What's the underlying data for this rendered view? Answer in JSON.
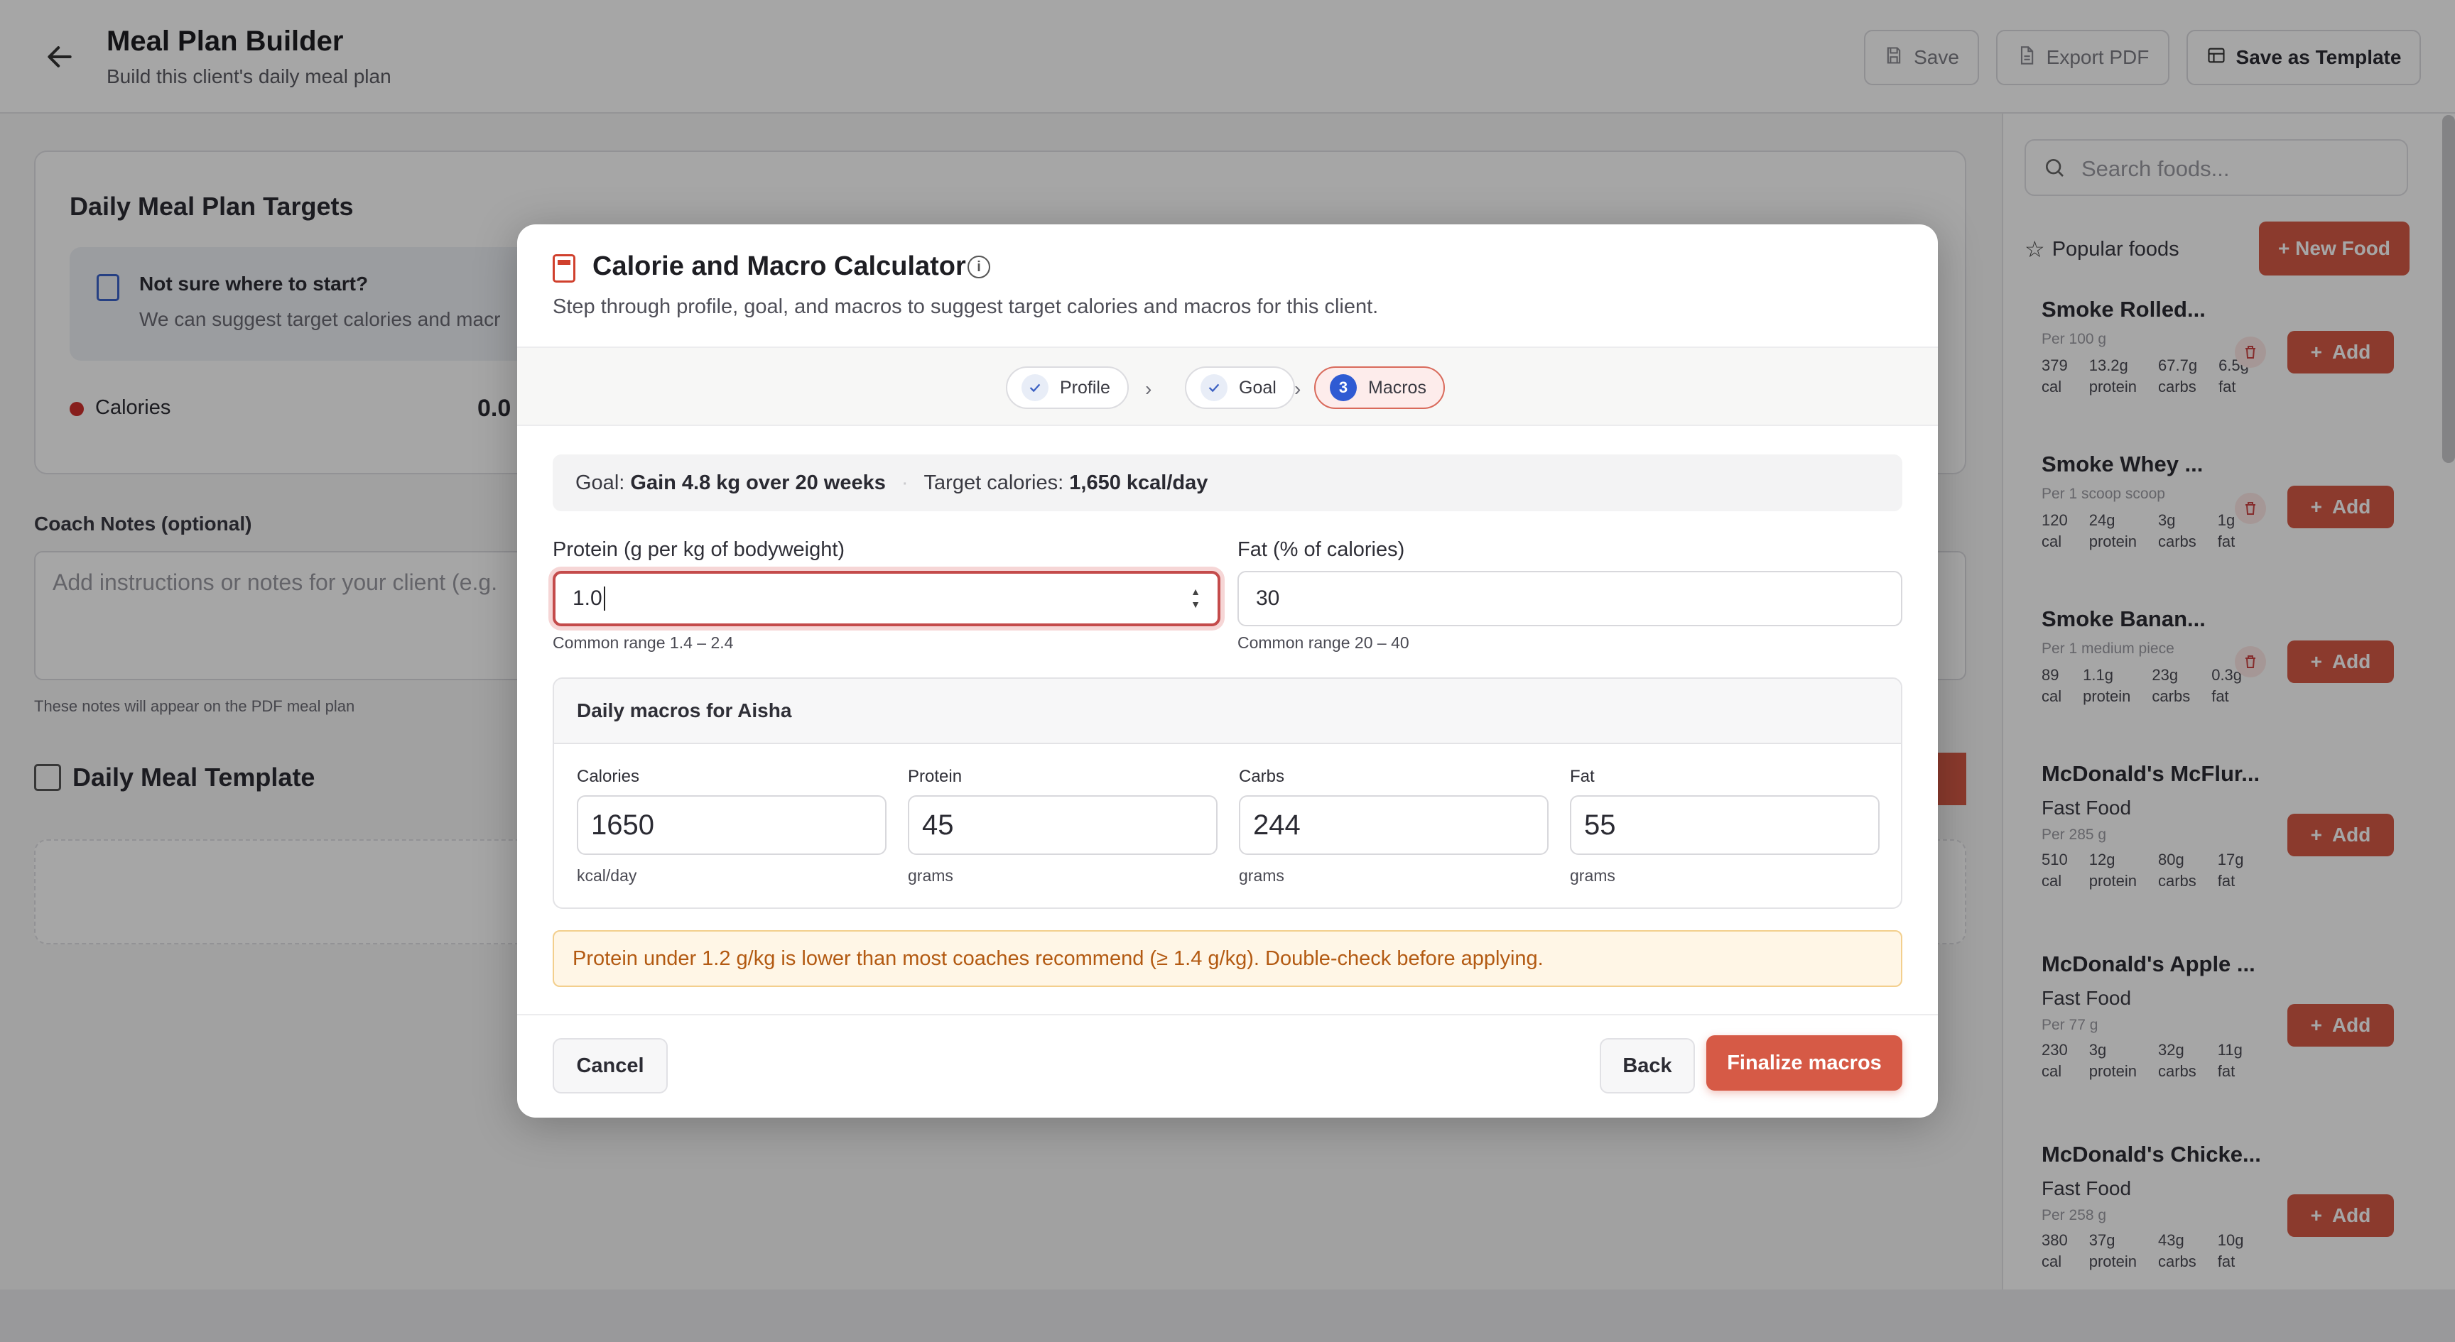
{
  "header": {
    "title": "Meal Plan Builder",
    "subtitle": "Build this client's daily meal plan",
    "buttons": {
      "save": "Save",
      "export": "Export PDF",
      "template": "Save as Template"
    }
  },
  "targets": {
    "title": "Daily Meal Plan Targets",
    "suggest_title": "Not sure where to start?",
    "suggest_body": "We can suggest target calories and macr",
    "calories_label": "Calories",
    "calories_value": "0.0"
  },
  "notes": {
    "label": "Coach Notes (optional)",
    "placeholder": "Add instructions or notes for your client (e.g.",
    "hint": "These notes will appear on the PDF meal plan"
  },
  "template": {
    "title": "Daily Meal Template"
  },
  "sidebar": {
    "search_placeholder": "Search foods...",
    "popular_label": "Popular foods",
    "new_food_label": "+ New Food",
    "add_label": "Add",
    "foods": [
      {
        "name": "Smoke Rolled...",
        "category": "",
        "per": "Per 100 g",
        "cal": "379",
        "protein": "13.2g",
        "carbs": "67.7g",
        "fat": "6.5g"
      },
      {
        "name": "Smoke Whey ...",
        "category": "",
        "per": "Per 1 scoop scoop",
        "cal": "120",
        "protein": "24g",
        "carbs": "3g",
        "fat": "1g"
      },
      {
        "name": "Smoke Banan...",
        "category": "",
        "per": "Per 1 medium piece",
        "cal": "89",
        "protein": "1.1g",
        "carbs": "23g",
        "fat": "0.3g"
      },
      {
        "name": "McDonald's McFlur...",
        "category": "Fast Food",
        "per": "Per 285 g",
        "cal": "510",
        "protein": "12g",
        "carbs": "80g",
        "fat": "17g"
      },
      {
        "name": "McDonald's Apple ...",
        "category": "Fast Food",
        "per": "Per 77 g",
        "cal": "230",
        "protein": "3g",
        "carbs": "32g",
        "fat": "11g"
      },
      {
        "name": "McDonald's Chicke...",
        "category": "Fast Food",
        "per": "Per 258 g",
        "cal": "380",
        "protein": "37g",
        "carbs": "43g",
        "fat": "10g"
      }
    ],
    "macro_units": {
      "cal": "cal",
      "protein": "protein",
      "carbs": "carbs",
      "fat": "fat"
    }
  },
  "modal": {
    "title": "Calorie and Macro Calculator",
    "description": "Step through profile, goal, and macros to suggest target calories and macros for this client.",
    "steps": [
      {
        "label": "Profile"
      },
      {
        "label": "Goal"
      },
      {
        "label": "Macros",
        "number": "3"
      }
    ],
    "goal_prefix": "Goal:",
    "goal_value": "Gain 4.8 kg over 20 weeks",
    "target_prefix": "Target calories:",
    "target_value": "1,650 kcal/day",
    "protein_label": "Protein (g per kg of bodyweight)",
    "protein_value": "1.0",
    "protein_hint": "Common range 1.4 – 2.4",
    "fat_label": "Fat (% of calories)",
    "fat_value": "30",
    "fat_hint": "Common range 20 – 40",
    "macros_title": "Daily macros for Aisha",
    "macros": [
      {
        "label": "Calories",
        "value": "1650",
        "unit": "kcal/day"
      },
      {
        "label": "Protein",
        "value": "45",
        "unit": "grams"
      },
      {
        "label": "Carbs",
        "value": "244",
        "unit": "grams"
      },
      {
        "label": "Fat",
        "value": "55",
        "unit": "grams"
      }
    ],
    "warning": "Protein under 1.2 g/kg is lower than most coaches recommend (≥ 1.4 g/kg). Double-check before applying.",
    "cancel": "Cancel",
    "back": "Back",
    "finalize": "Finalize macros"
  },
  "colors": {
    "accent": "#d65a46",
    "warning_text": "#b35a12",
    "step_number": "#2f5bd3"
  }
}
